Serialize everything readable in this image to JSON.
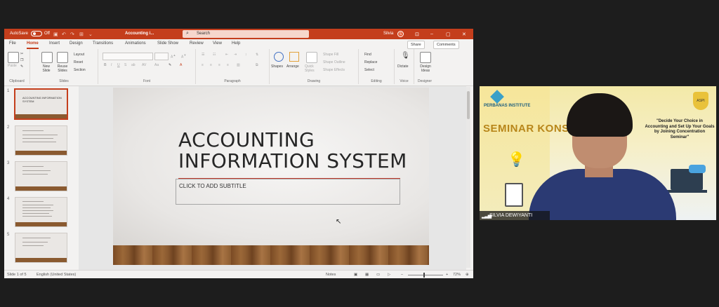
{
  "window": {
    "autosave_label": "AutoSave",
    "autosave_state": "Off",
    "file_title": "Accounting i...",
    "search_placeholder": "Search",
    "user_name": "Silvia",
    "user_initial": "S"
  },
  "ribbon_tabs": [
    "File",
    "Home",
    "Insert",
    "Design",
    "Transitions",
    "Animations",
    "Slide Show",
    "Review",
    "View",
    "Help"
  ],
  "active_tab": "Home",
  "share_label": "Share",
  "comments_label": "Comments",
  "ribbon": {
    "clipboard": {
      "paste": "Paste",
      "group": "Clipboard"
    },
    "slides": {
      "new_slide": "New Slide",
      "reuse_slides": "Reuse Slides",
      "layout": "Layout",
      "reset": "Reset",
      "section": "Section",
      "group": "Slides"
    },
    "font": {
      "group": "Font"
    },
    "paragraph": {
      "group": "Paragraph"
    },
    "drawing": {
      "shapes": "Shapes",
      "arrange": "Arrange",
      "quick_styles": "Quick Styles",
      "shape_fill": "Shape Fill",
      "shape_outline": "Shape Outline",
      "shape_effects": "Shape Effects",
      "group": "Drawing"
    },
    "editing": {
      "find": "Find",
      "replace": "Replace",
      "select": "Select",
      "group": "Editing"
    },
    "voice": {
      "dictate": "Dictate",
      "group": "Voice"
    },
    "designer": {
      "design_ideas": "Design Ideas",
      "group": "Designer"
    }
  },
  "slides": [
    {
      "number": "1",
      "title": "ACCOUNTING INFORMATION SYSTEM"
    },
    {
      "number": "2",
      "title": ""
    },
    {
      "number": "3",
      "title": ""
    },
    {
      "number": "4",
      "title": ""
    },
    {
      "number": "5",
      "title": ""
    }
  ],
  "current_slide": {
    "title": "ACCOUNTING INFORMATION SYSTEM",
    "subtitle_placeholder": "CLICK TO ADD SUBTITLE"
  },
  "status_bar": {
    "slide_counter": "Slide 1 of 5",
    "language": "English (United States)",
    "notes": "Notes",
    "zoom": "72%"
  },
  "video": {
    "logo_text": "PERBANAS INSTITUTE",
    "banner": "SEMINAR KONSENTRASI",
    "quote": "\"Decide Your Choice in Accounting and Set Up Your Goals by Joining Concentration Seminar\"",
    "badge": "ASPI",
    "participant_name": "SILVIA DEWIYANTI"
  }
}
